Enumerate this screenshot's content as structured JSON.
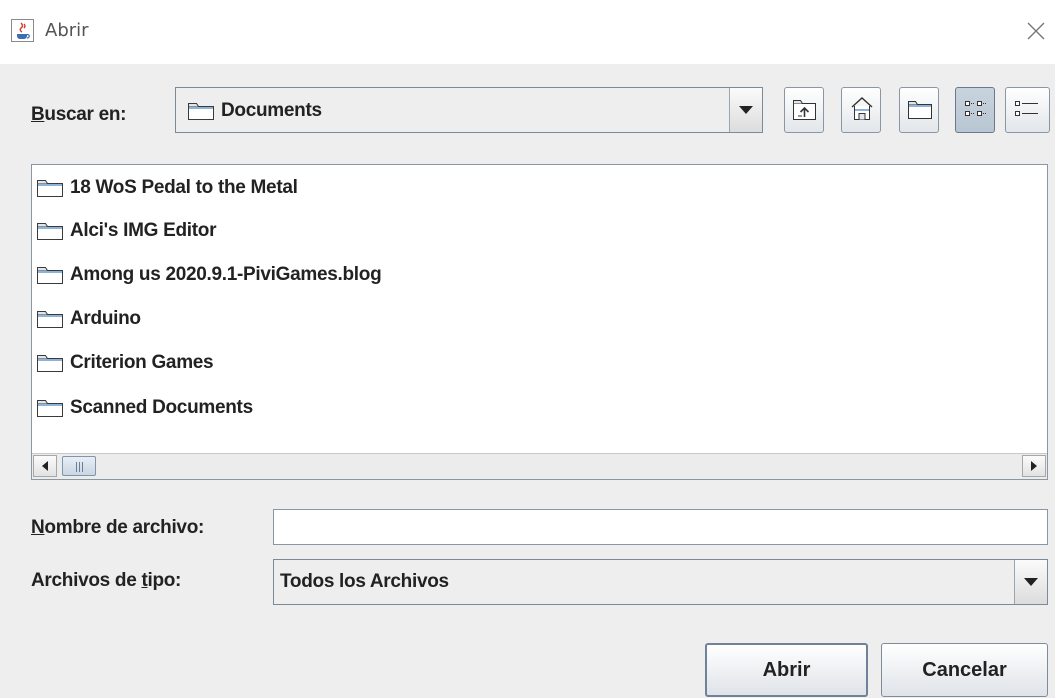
{
  "window": {
    "title": "Abrir",
    "app_icon": "java-coffee-icon",
    "close_icon": "close-icon"
  },
  "look_in": {
    "label_mnemonic": "B",
    "label_rest": "uscar en:",
    "selected": "Documents",
    "selected_icon": "folder-icon"
  },
  "toolbar": {
    "buttons": [
      {
        "name": "up-one-level-button",
        "icon": "folder-up-icon"
      },
      {
        "name": "home-button",
        "icon": "home-icon"
      },
      {
        "name": "new-folder-button",
        "icon": "new-folder-icon"
      },
      {
        "name": "list-view-button",
        "icon": "list-view-icon",
        "pressed": true
      },
      {
        "name": "details-view-button",
        "icon": "details-view-icon",
        "pressed": false
      }
    ]
  },
  "files": [
    {
      "name": "18 WoS Pedal to the Metal",
      "icon": "folder-icon"
    },
    {
      "name": "Alci's IMG Editor",
      "icon": "folder-icon"
    },
    {
      "name": "Among us 2020.9.1-PiviGames.blog",
      "icon": "folder-icon"
    },
    {
      "name": "Arduino",
      "icon": "folder-icon"
    },
    {
      "name": "Criterion Games",
      "icon": "folder-icon"
    },
    {
      "name": "Scanned Documents",
      "icon": "folder-icon"
    }
  ],
  "file_name": {
    "label_mnemonic": "N",
    "label_rest": "ombre de archivo:",
    "value": ""
  },
  "file_type": {
    "label_before": "Archivos de ",
    "label_mnemonic": "t",
    "label_after": "ipo:",
    "selected": "Todos los Archivos"
  },
  "actions": {
    "open_label": "Abrir",
    "cancel_label": "Cancelar"
  }
}
